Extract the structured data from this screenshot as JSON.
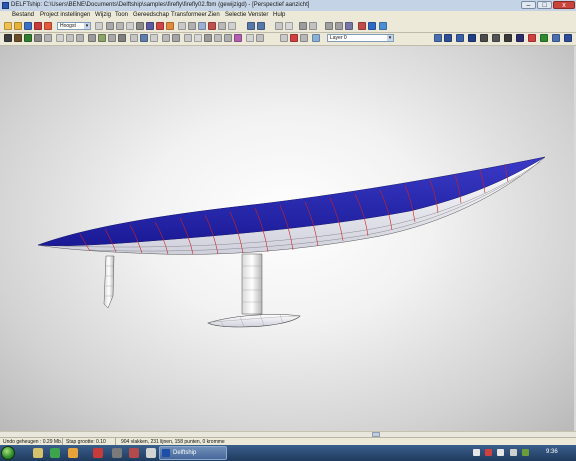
{
  "window": {
    "title": "DELFTship: C:\\Users\\BENE\\Documents\\Delftship\\samples\\firefly\\firefly02.fbm (gewijzigd) - [Perspectief aanzicht]"
  },
  "window_buttons": {
    "minimize": "–",
    "maximize": "□",
    "close": "x"
  },
  "menu": {
    "items": [
      "Bestand",
      "Project instellingen",
      "Wijzig",
      "Toon",
      "Gereedschap",
      "Transformeer",
      "Zien",
      "Selectie",
      "Venster",
      "Hulp"
    ]
  },
  "toolbar": {
    "combo_view": "Hoogst",
    "combo_layer": "Layer 0"
  },
  "statusbar": {
    "undo": "Undo geheugen : 0.29 Mb.",
    "step": "Stap grootte: 0.10",
    "stats": "904 vlakken, 231 lijnen, 158 punten, 0 kromme"
  },
  "taskbar": {
    "app_label": "Delftship",
    "clock": "9:36"
  },
  "colors": {
    "hull_top": "#2a2ab4",
    "hull_bottom": "#e6e6ee",
    "station_lines": "#cc2222",
    "background": "#e8e8e8"
  }
}
